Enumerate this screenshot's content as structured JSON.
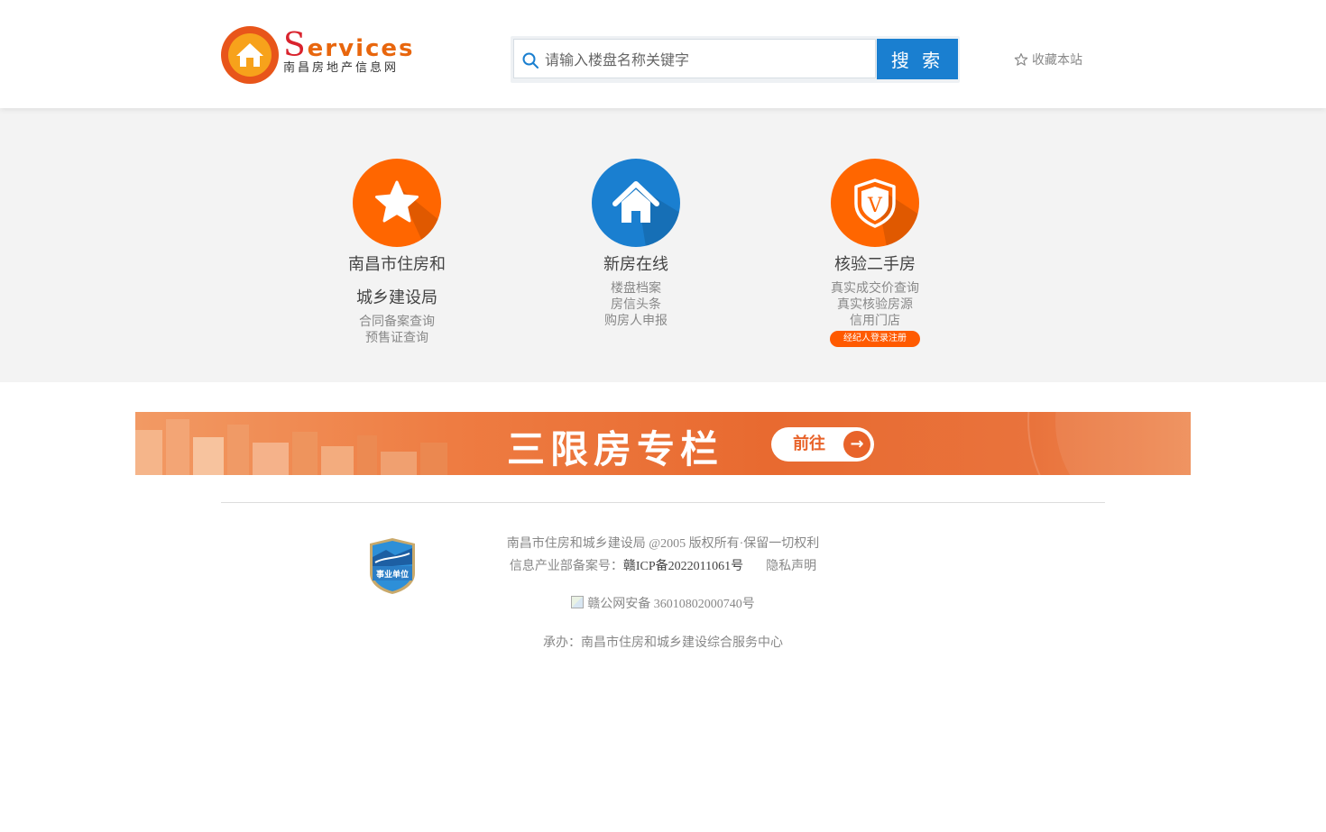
{
  "header": {
    "logo_brand_first": "S",
    "logo_brand_rest": "ervices",
    "logo_subtitle": "南昌房地产信息网",
    "search_placeholder": "请输入楼盘名称关键字",
    "search_button": "搜 索",
    "favorite_label": "收藏本站"
  },
  "services": [
    {
      "title_line1": "南昌市住房和",
      "title_line2": "城乡建设局",
      "links": [
        "合同备案查询",
        "预售证查询"
      ],
      "icon": "star-icon",
      "color": "#ff6600"
    },
    {
      "title_line1": "新房在线",
      "links": [
        "楼盘档案",
        "房信头条",
        "购房人申报"
      ],
      "icon": "house-icon",
      "color": "#1a7fd0"
    },
    {
      "title_line1": "核验二手房",
      "links": [
        "真实成交价查询",
        "真实核验房源",
        "信用门店"
      ],
      "button": "经纪人登录注册",
      "icon": "shield-v-icon",
      "color": "#ff6600"
    }
  ],
  "banner": {
    "title": "三限房专栏",
    "button": "前往",
    "arrow": "→"
  },
  "footer": {
    "copyright": "南昌市住房和城乡建设局 @2005 版权所有·保留一切权利",
    "icp_prefix": "信息产业部备案号：",
    "icp_number": "赣ICP备2022011061号",
    "privacy": "隐私声明",
    "police_record": "赣公网安备 36010802000740号",
    "organizer": "承办：南昌市住房和城乡建设综合服务中心",
    "badge_text": "事业单位"
  }
}
